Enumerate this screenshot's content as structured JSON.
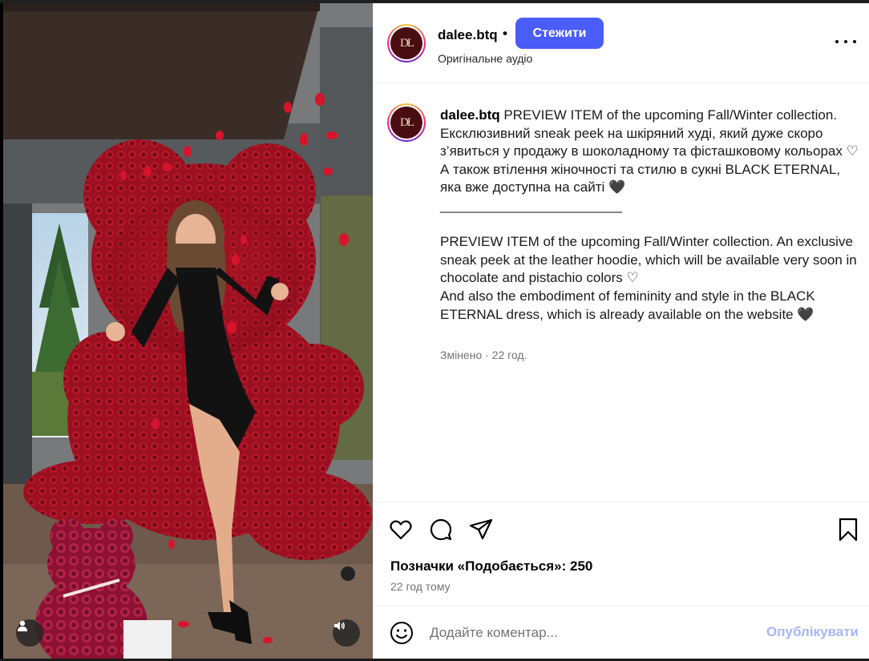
{
  "post": {
    "username": "dalee.btq",
    "separator": "•",
    "follow_label": "Стежити",
    "audio_label": "Оригінальне аудіо",
    "avatar_monogram": "DL",
    "caption_username": "dalee.btq",
    "caption_text": " PREVIEW ITEM of the upcoming Fall/Winter collection.\nЕксклюзивний sneak peek на шкіряний худі, який дуже скоро з’явиться у продажу в шоколадному та фісташковому кольорах ♡\nА також втілення жіночності та стилю в сукні BLACK ETERNAL, яка вже доступна на сайті 🖤\n________________________\n\nPREVIEW ITEM of the upcoming Fall/Winter collection. An exclusive sneak peek at the leather hoodie, which will be available very soon in chocolate and pistachio colors ♡\nAnd also the embodiment of femininity and style in the BLACK ETERNAL dress, which is already available on the website 🖤",
    "edited_label": "Змінено · 22 год.",
    "likes_label": "Позначки «Подобається»: 250",
    "time_ago": "22 год тому",
    "comment_placeholder": "Додайте коментар...",
    "publish_label": "Опублікувати"
  },
  "icons": {
    "like": "heart-icon",
    "comment": "comment-icon",
    "share": "send-icon",
    "save": "bookmark-icon",
    "more": "more-horizontal-icon",
    "emoji": "emoji-icon",
    "tag_user": "user-tag-icon",
    "sound": "speaker-icon"
  },
  "colors": {
    "follow_button": "#4a5df9",
    "publish_disabled": "#a6b6fb",
    "avatar_bg": "#4a0d12"
  }
}
